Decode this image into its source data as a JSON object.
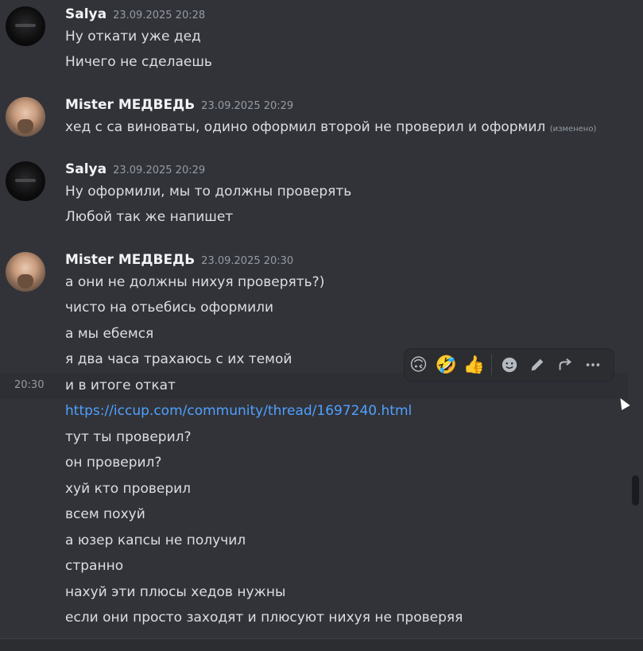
{
  "messages": [
    {
      "author": "Salya",
      "timestamp": "23.09.2025 20:28",
      "lines": [
        "Ну откати уже дед",
        "Ничего не сделаешь"
      ]
    },
    {
      "author": "Mister МЕДВЕДЬ",
      "timestamp": "23.09.2025 20:29",
      "lines": [
        "хед с са виноваты, одино оформил второй не проверил и оформил"
      ],
      "edited_label": "(изменено)"
    },
    {
      "author": "Salya",
      "timestamp": "23.09.2025 20:29",
      "lines": [
        "Ну оформили, мы то должны проверять",
        "Любой так же напишет"
      ]
    },
    {
      "author": "Mister МЕДВЕДЬ",
      "timestamp": "23.09.2025 20:30",
      "lines": [
        "а они не должны нихуя проверять?)",
        "чисто на отьебись оформили",
        "а мы ебемся",
        "я два часа трахаюсь с их темой",
        "и в итоге откат",
        "https://iccup.com/community/thread/1697240.html",
        "тут ты проверил?",
        "он проверил?",
        "хуй кто проверил",
        "всем похуй",
        "а юзер капсы не получил",
        "странно",
        "нахуй эти плюсы хедов нужны",
        "если они просто заходят и плюсуют нихуя не проверяя"
      ]
    }
  ],
  "hover": {
    "time": "20:30"
  },
  "toolbar": {
    "reactions": [
      "🙃",
      "🤣",
      "👍"
    ],
    "icons": [
      "add-reaction-icon",
      "edit-icon",
      "reply-icon",
      "more-icon"
    ]
  }
}
